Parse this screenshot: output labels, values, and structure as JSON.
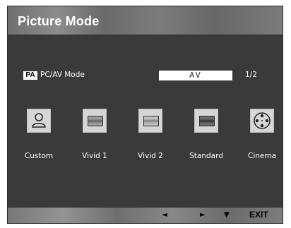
{
  "title": "Picture Mode",
  "mode": {
    "icon_text": "PA",
    "label": "PC/AV Mode",
    "value": "AV",
    "page": "1/2"
  },
  "presets": [
    {
      "label": "Custom",
      "icon": "person-icon"
    },
    {
      "label": "Vivid 1",
      "icon": "screen-icon"
    },
    {
      "label": "Vivid 2",
      "icon": "screen-icon"
    },
    {
      "label": "Standard",
      "icon": "screen-icon"
    },
    {
      "label": "Cinema",
      "icon": "film-reel-icon"
    }
  ],
  "nav": {
    "left": "◄",
    "right": "►",
    "down": "▼",
    "exit": "EXIT"
  }
}
